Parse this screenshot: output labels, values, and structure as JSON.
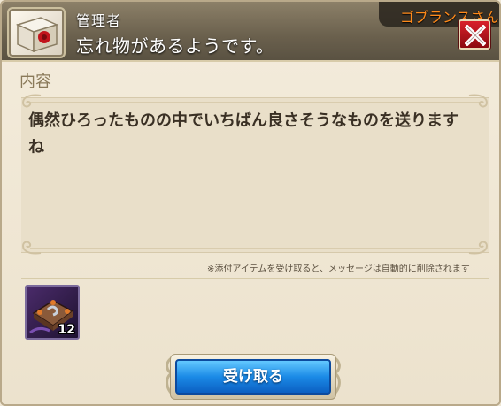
{
  "header": {
    "sender": "管理者",
    "subject": "忘れ物があるようです。",
    "name_tag": "ゴブランスさんか",
    "close_label": "X"
  },
  "content": {
    "label": "内容",
    "message": "偶然ひろったものの中でいちばん良さそうなものを送ります\nね"
  },
  "notice": "※添付アイテムを受け取ると、メッセージは自動的に削除されます",
  "attachment": {
    "icon": "tome-item-icon",
    "count": "12"
  },
  "receive_button": {
    "label": "受け取る"
  },
  "colors": {
    "name_tag": "#ff8a1a",
    "close_button": "#d8202a",
    "receive_button": "#1b8ae6"
  }
}
